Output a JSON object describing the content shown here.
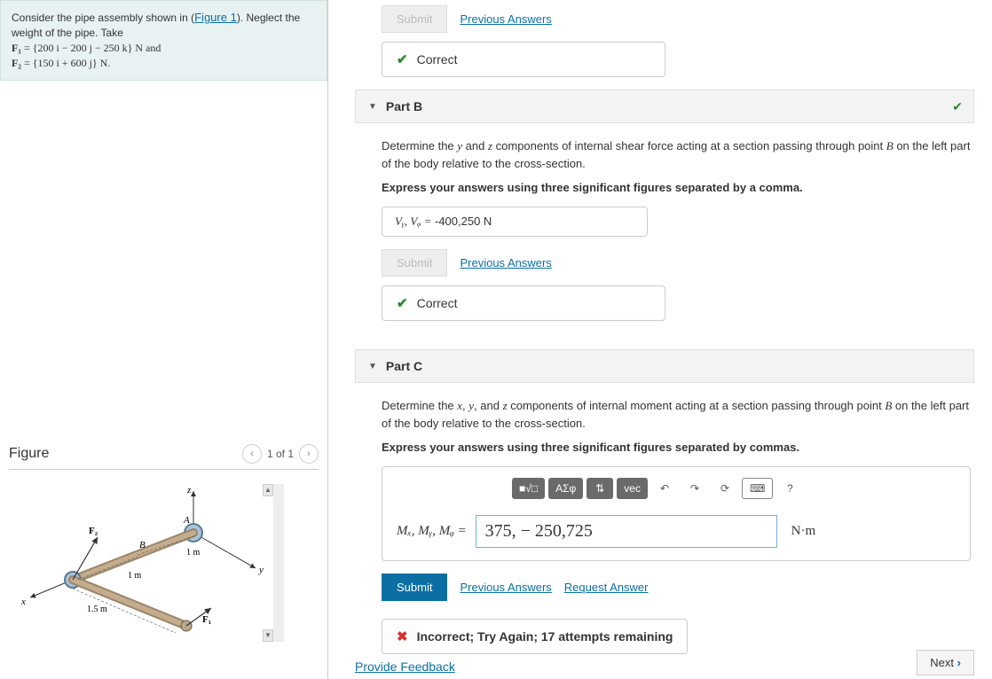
{
  "problem": {
    "intro": "Consider the pipe assembly shown in (",
    "figlink": "Figure 1",
    "intro2": "). Neglect the weight of the pipe. Take",
    "f1_label": "F₁",
    "f1_val": " = {200 i − 200 j − 250 k} N and",
    "f2_label": "F₂",
    "f2_val": " = {150 i + 600 j} N."
  },
  "figure": {
    "title": "Figure",
    "counter": "1 of 1",
    "labels": {
      "z": "z",
      "y": "y",
      "x": "x",
      "A": "A",
      "B": "B",
      "F1": "F₁",
      "F2": "F₂",
      "d1": "1 m",
      "d2": "1 m",
      "d3": "1.5 m"
    }
  },
  "partA_trail": {
    "submit": "Submit",
    "prev": "Previous Answers",
    "correct": "Correct"
  },
  "partB": {
    "title": "Part B",
    "desc1": "Determine the ",
    "var1": "y",
    "desc2": " and ",
    "var2": "z",
    "desc3": " components of internal shear force acting at a section passing through point ",
    "pt": "B",
    "desc4": " on the left part of the body relative to the cross-section.",
    "instr": "Express your answers using three significant figures separated by a comma.",
    "ans_label": "Vᵧ, Vᵩ =",
    "ans_val": " -400,250  N",
    "submit": "Submit",
    "prev": "Previous Answers",
    "correct": "Correct"
  },
  "partC": {
    "title": "Part C",
    "desc1": "Determine the ",
    "v1": "x",
    "v2": "y",
    "v3": "z",
    "desc2": ", ",
    "desc3": ", and ",
    "desc4": " components of internal moment acting at a section passing through point ",
    "pt": "B",
    "desc5": " on the left part of the body relative to the cross-section.",
    "instr": "Express your answers using three significant figures separated by commas.",
    "tb": {
      "tmpl": "■√□",
      "greek": "ΑΣφ",
      "sort": "⇅",
      "vec": "vec",
      "undo": "↶",
      "redo": "↷",
      "reset": "⟳",
      "kbd": "⌨",
      "help": "?"
    },
    "eq_label": "Mₓ, Mᵧ, Mᵩ =",
    "eq_val": "375, − 250,725",
    "eq_unit": "N·m",
    "submit": "Submit",
    "prev": "Previous Answers",
    "req": "Request Answer",
    "incorrect": "Incorrect; Try Again; 17 attempts remaining"
  },
  "footer": {
    "feedback": "Provide Feedback",
    "next": "Next"
  }
}
